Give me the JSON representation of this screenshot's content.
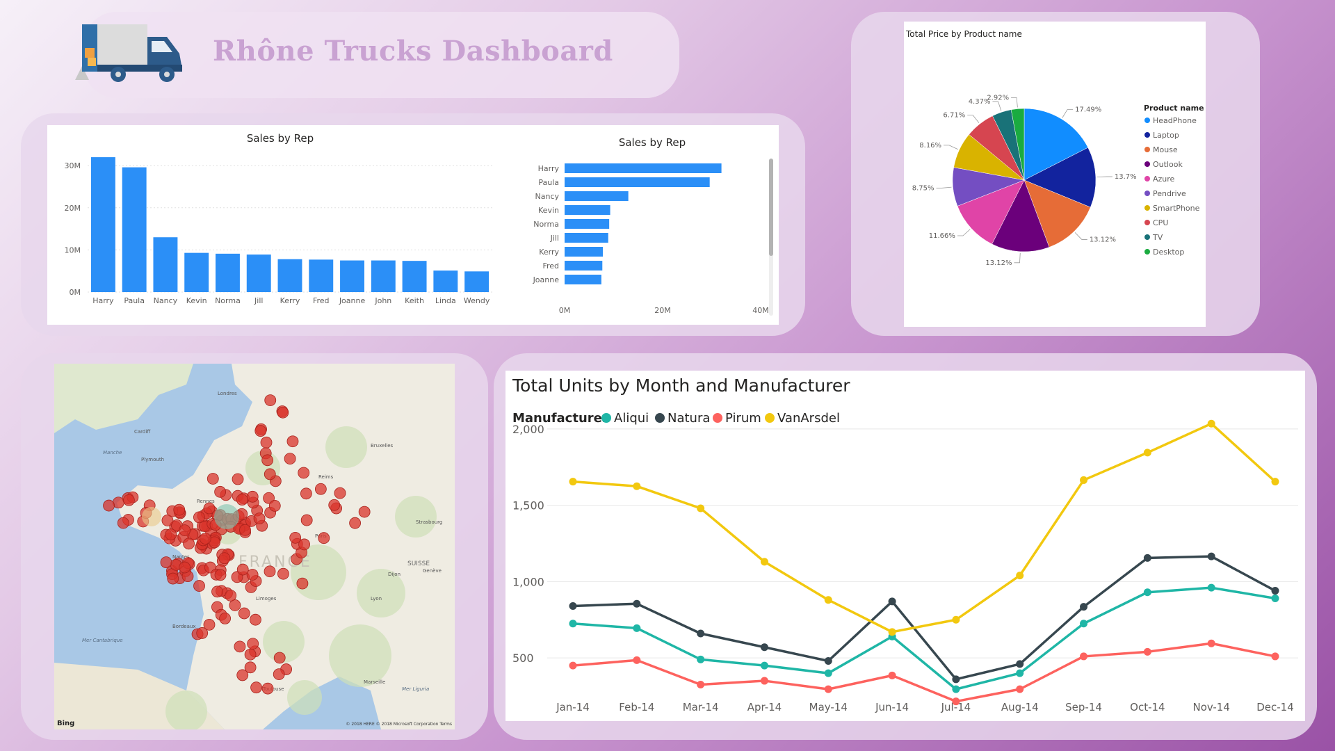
{
  "dashboard": {
    "title": "Rhône Trucks Dashboard",
    "logo_icon": "delivery-truck-icon"
  },
  "chart_data": [
    {
      "id": "sales-column",
      "type": "bar",
      "orientation": "vertical",
      "title": "Sales by Rep",
      "categories": [
        "Harry",
        "Paula",
        "Nancy",
        "Kevin",
        "Norma",
        "Jill",
        "Kerry",
        "Fred",
        "Joanne",
        "John",
        "Keith",
        "Linda",
        "Wendy"
      ],
      "values": [
        32.0,
        29.6,
        13.0,
        9.3,
        9.1,
        8.9,
        7.8,
        7.7,
        7.5,
        7.5,
        7.4,
        5.1,
        4.9
      ],
      "unit": "M",
      "yticks": [
        "0M",
        "10M",
        "20M",
        "30M"
      ],
      "ylim": [
        0,
        33
      ],
      "color": "#2b8ff7",
      "grid": true
    },
    {
      "id": "sales-horizontal",
      "type": "bar",
      "orientation": "horizontal",
      "title": "Sales by Rep",
      "categories": [
        "Harry",
        "Paula",
        "Nancy",
        "Kevin",
        "Norma",
        "Jill",
        "Kerry",
        "Fred",
        "Joanne"
      ],
      "values": [
        32.0,
        29.6,
        13.0,
        9.3,
        9.1,
        8.9,
        7.8,
        7.7,
        7.5
      ],
      "unit": "M",
      "xticks": [
        "0M",
        "20M",
        "40M"
      ],
      "xlim": [
        0,
        40
      ],
      "color": "#2b8ff7"
    },
    {
      "id": "price-pie",
      "type": "pie",
      "title": "Total Price by Product name",
      "legend_title": "Product name",
      "legend_position": "right",
      "slices": [
        {
          "label": "HeadPhone",
          "value": 17.49,
          "display": "17.49%",
          "color": "#118dff"
        },
        {
          "label": "Laptop",
          "value": 13.7,
          "display": "13.7%",
          "color": "#12239e"
        },
        {
          "label": "Mouse",
          "value": 13.12,
          "display": "13.12%",
          "color": "#e66c37"
        },
        {
          "label": "Outlook",
          "value": 13.12,
          "display": "13.12%",
          "color": "#6b007b"
        },
        {
          "label": "Azure",
          "value": 11.66,
          "display": "11.66%",
          "color": "#e044a7"
        },
        {
          "label": "Pendrive",
          "value": 8.75,
          "display": "8.75%",
          "color": "#744ec2"
        },
        {
          "label": "SmartPhone",
          "value": 8.16,
          "display": "8.16%",
          "color": "#d9b300"
        },
        {
          "label": "CPU",
          "value": 6.71,
          "display": "6.71%",
          "color": "#d64550"
        },
        {
          "label": "TV",
          "value": 4.37,
          "display": "4.37%",
          "color": "#197278"
        },
        {
          "label": "Desktop",
          "value": 2.92,
          "display": "2.92%",
          "color": "#1aab40"
        }
      ]
    },
    {
      "id": "units-line",
      "type": "line",
      "title": "Total Units by Month and Manufacturer",
      "legend_title": "Manufacturer",
      "legend_position": "top-left",
      "x": [
        "Jan-14",
        "Feb-14",
        "Mar-14",
        "Apr-14",
        "May-14",
        "Jun-14",
        "Jul-14",
        "Aug-14",
        "Sep-14",
        "Oct-14",
        "Nov-14",
        "Dec-14"
      ],
      "yticks": [
        "500",
        "1,000",
        "1,500",
        "2,000"
      ],
      "ytick_values": [
        500,
        1000,
        1500,
        2000
      ],
      "ylim": [
        250,
        2200
      ],
      "grid": true,
      "series": [
        {
          "name": "Aliqui",
          "color": "#1fb6a6",
          "values": [
            725,
            695,
            490,
            450,
            400,
            640,
            295,
            400,
            725,
            930,
            960,
            890
          ]
        },
        {
          "name": "Natura",
          "color": "#37474f",
          "values": [
            840,
            855,
            660,
            570,
            480,
            870,
            360,
            460,
            835,
            1155,
            1165,
            940
          ]
        },
        {
          "name": "Pirum",
          "color": "#fd625e",
          "values": [
            450,
            485,
            325,
            350,
            295,
            385,
            215,
            295,
            510,
            540,
            595,
            510
          ]
        },
        {
          "name": "VanArsdel",
          "color": "#f2c80f",
          "values": [
            1655,
            1625,
            1480,
            1130,
            880,
            670,
            750,
            1040,
            1665,
            1845,
            2035,
            1655
          ]
        }
      ]
    }
  ],
  "map": {
    "provider": "Bing",
    "copyright": "© 2018 HERE © 2018 Microsoft Corporation Terms",
    "country_label": "FRANCE",
    "neighbor_label": "SUISSE",
    "cities": [
      {
        "name": "Londres"
      },
      {
        "name": "Cardiff"
      },
      {
        "name": "Plymouth"
      },
      {
        "name": "Paris"
      },
      {
        "name": "Lyon"
      },
      {
        "name": "Bordeaux"
      },
      {
        "name": "Marseille"
      },
      {
        "name": "Nantes"
      },
      {
        "name": "Rennes"
      },
      {
        "name": "Strasbourg"
      },
      {
        "name": "Bruxelles"
      },
      {
        "name": "Genève"
      },
      {
        "name": "Toulouse"
      },
      {
        "name": "Dijon"
      },
      {
        "name": "Reims"
      },
      {
        "name": "Limoges"
      }
    ],
    "sea_labels": [
      "Manche",
      "Mer Cantabrique",
      "Mer Liguria"
    ],
    "marker_color": "#d9342b"
  }
}
